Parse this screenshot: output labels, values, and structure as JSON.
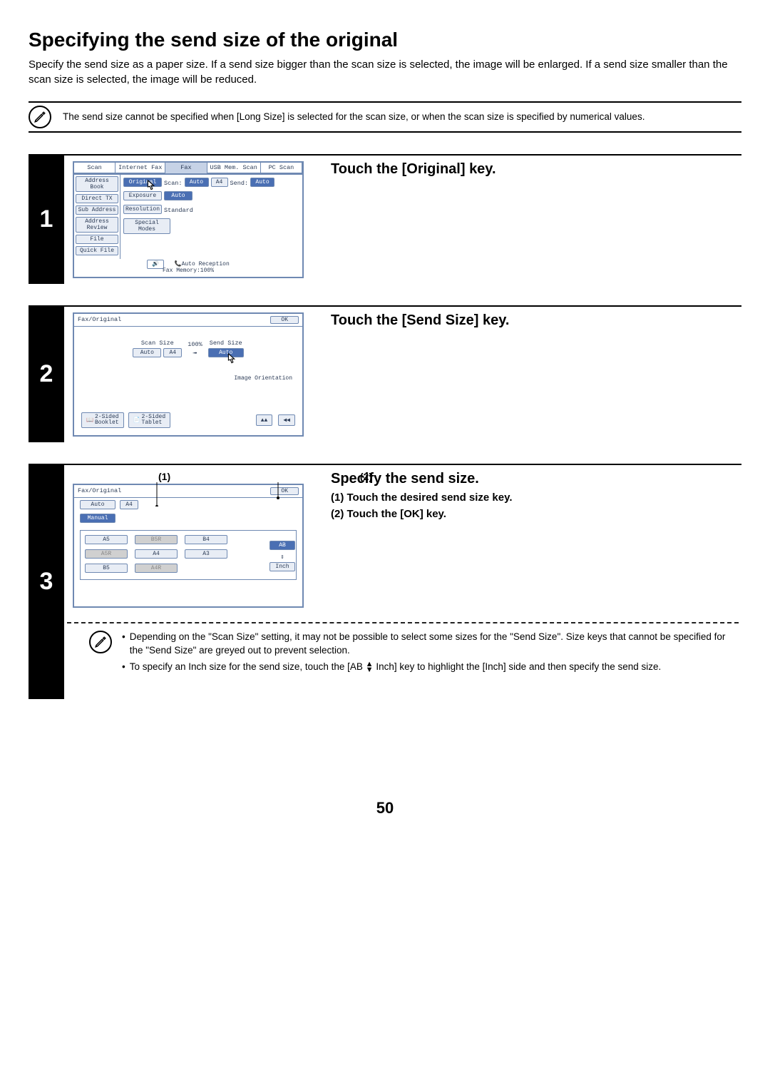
{
  "title": "Specifying the send size of the original",
  "intro": "Specify the send size as a paper size. If a send size bigger than the scan size is selected, the image will be enlarged. If a send size smaller than the scan size is selected, the image will be reduced.",
  "top_note": "The send size cannot be specified when [Long Size] is selected for the scan size, or when the scan size is specified by numerical values.",
  "step1": {
    "num": "1",
    "heading": "Touch the [Original] key.",
    "panel": {
      "tabs": [
        "Scan",
        "Internet Fax",
        "Fax",
        "USB Mem. Scan",
        "PC Scan"
      ],
      "tab_selected": 2,
      "side": [
        "Address Book",
        "Direct TX",
        "Sub Address",
        "Address Review",
        "File",
        "Quick File"
      ],
      "row1": {
        "original": "Original",
        "scan_lbl": "Scan:",
        "auto": "Auto",
        "size": "A4",
        "send_lbl": "Send:",
        "send_auto": "Auto"
      },
      "row2": {
        "exposure": "Exposure",
        "auto": "Auto"
      },
      "row3": {
        "resolution": "Resolution",
        "standard": "Standard"
      },
      "row4": {
        "special": "Special Modes"
      },
      "foot1": "Auto Reception",
      "foot2": "Fax Memory:100%"
    }
  },
  "step2": {
    "num": "2",
    "heading": "Touch the [Send Size] key.",
    "panel": {
      "title": "Fax/Original",
      "ok": "OK",
      "scan_size_lbl": "Scan Size",
      "ratio": "100%",
      "send_size_lbl": "Send Size",
      "auto": "Auto",
      "size": "A4",
      "img_orient": "Image Orientation",
      "twosided_1": "2-Sided\nBooklet",
      "twosided_2": "2-Sided\nTablet"
    }
  },
  "step3": {
    "num": "3",
    "heading": "Specify the send size.",
    "sub1": "(1)  Touch the desired send size key.",
    "sub2": "(2)  Touch the [OK] key.",
    "callout1": "(1)",
    "callout2": "(2)",
    "panel": {
      "title": "Fax/Original",
      "ok": "OK",
      "auto": "Auto",
      "a4": "A4",
      "manual": "Manual",
      "sizes": [
        "A5",
        "B5R",
        "B4",
        "A5R",
        "A4",
        "A3",
        "B5",
        "A4R"
      ],
      "greyed": [
        1,
        3,
        7
      ],
      "ab": "AB",
      "inch": "Inch"
    },
    "note1": "Depending on the \"Scan Size\" setting, it may not be possible to select some sizes for the \"Send Size\". Size keys that cannot be specified for the \"Send Size\" are greyed out to prevent selection.",
    "note2_a": "To specify an Inch size for the send size, touch the [AB ",
    "note2_b": " Inch] key to highlight the [Inch] side and then specify the send size."
  },
  "page_number": "50"
}
